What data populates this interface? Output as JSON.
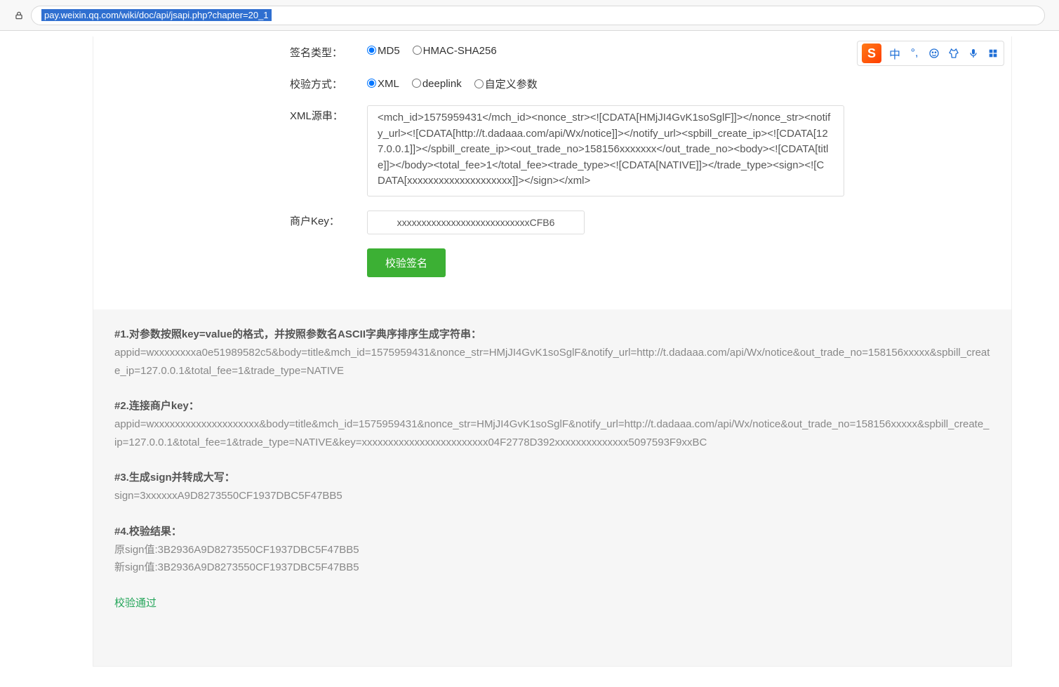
{
  "address_bar": {
    "url": "pay.weixin.qq.com/wiki/doc/api/jsapi.php?chapter=20_1"
  },
  "toolbar": {
    "logo_letter": "S",
    "cn_label": "中"
  },
  "form": {
    "sign_type_label": "签名类型：",
    "sign_types": [
      "MD5",
      "HMAC-SHA256"
    ],
    "sign_type_selected": "MD5",
    "verify_mode_label": "校验方式：",
    "verify_modes": [
      "XML",
      "deeplink",
      "自定义参数"
    ],
    "verify_mode_selected": "XML",
    "xml_label": "XML源串：",
    "xml_value": "<mch_id>1575959431</mch_id><nonce_str><![CDATA[HMjJI4GvK1soSglF]]></nonce_str><notify_url><![CDATA[http://t.dadaaa.com/api/Wx/notice]]></notify_url><spbill_create_ip><![CDATA[127.0.0.1]]></spbill_create_ip><out_trade_no>158156xxxxxxx</out_trade_no><body><![CDATA[title]]></body><total_fee>1</total_fee><trade_type><![CDATA[NATIVE]]></trade_type><sign><![CDATA[xxxxxxxxxxxxxxxxxxxx]]></sign></xml>",
    "key_label": "商户Key：",
    "key_value": "xxxxxxxxxxxxxxxxxxxxxxxxxxxCFB6",
    "button_label": "校验签名"
  },
  "result": {
    "step1_title": "#1.对参数按照key=value的格式，并按照参数名ASCII字典序排序生成字符串：",
    "step1_body": "appid=wxxxxxxxxa0e51989582c5&body=title&mch_id=1575959431&nonce_str=HMjJI4GvK1soSglF&notify_url=http://t.dadaaa.com/api/Wx/notice&out_trade_no=158156xxxxx&spbill_create_ip=127.0.0.1&total_fee=1&trade_type=NATIVE",
    "step2_title": "#2.连接商户key：",
    "step2_body": "appid=wxxxxxxxxxxxxxxxxxxxx&body=title&mch_id=1575959431&nonce_str=HMjJI4GvK1soSglF&notify_url=http://t.dadaaa.com/api/Wx/notice&out_trade_no=158156xxxxx&spbill_create_ip=127.0.0.1&total_fee=1&trade_type=NATIVE&key=xxxxxxxxxxxxxxxxxxxxxxxx04F2778D392xxxxxxxxxxxxxx5097593F9xxBC",
    "step3_title": "#3.生成sign并转成大写：",
    "step3_body": "sign=3xxxxxxA9D8273550CF1937DBC5F47BB5",
    "step4_title": "#4.校验结果：",
    "step4_body_a": "原sign值:3B2936A9D8273550CF1937DBC5F47BB5",
    "step4_body_b": "新sign值:3B2936A9D8273550CF1937DBC5F47BB5",
    "pass_text": "校验通过"
  }
}
